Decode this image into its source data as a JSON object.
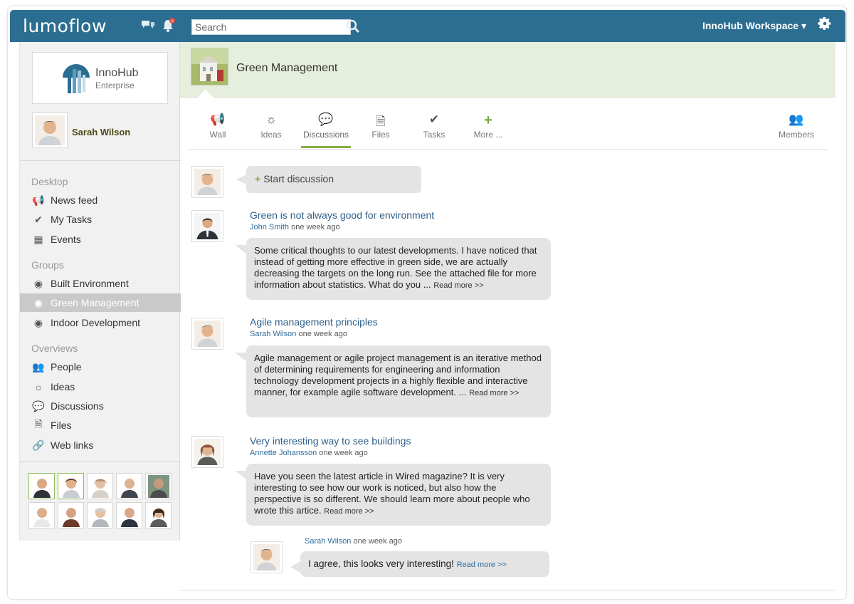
{
  "topbar": {
    "logo": "lumoflow",
    "search_placeholder": "Search",
    "workspace": "InnoHub Workspace ▾",
    "accent": "#2b6e91"
  },
  "sidebar": {
    "brand": {
      "name": "InnoHub",
      "sub": "Enterprise"
    },
    "user": {
      "name": "Sarah Wilson"
    },
    "sections": {
      "desktop": "Desktop",
      "groups": "Groups",
      "overviews": "Overviews"
    },
    "desktop_items": [
      {
        "label": "News feed",
        "icon": "megaphone-icon"
      },
      {
        "label": "My Tasks",
        "icon": "check-circle-icon"
      },
      {
        "label": "Events",
        "icon": "calendar-icon"
      }
    ],
    "group_items": [
      {
        "label": "Built Environment",
        "icon": "group-icon"
      },
      {
        "label": "Green Management",
        "icon": "group-icon",
        "active": true
      },
      {
        "label": "Indoor Development",
        "icon": "group-icon"
      }
    ],
    "overview_items": [
      {
        "label": "People",
        "icon": "people-icon"
      },
      {
        "label": "Ideas",
        "icon": "lightbulb-icon"
      },
      {
        "label": "Discussions",
        "icon": "speech-bubbles-icon"
      },
      {
        "label": "Files",
        "icon": "file-icon"
      },
      {
        "label": "Web links",
        "icon": "link-icon"
      }
    ]
  },
  "group": {
    "title": "Green Management",
    "header_color": "#e6eedd"
  },
  "tabs": [
    {
      "label": "Wall",
      "icon": "megaphone-icon"
    },
    {
      "label": "Ideas",
      "icon": "lightbulb-icon"
    },
    {
      "label": "Discussions",
      "icon": "speech-bubbles-icon",
      "active": true
    },
    {
      "label": "Files",
      "icon": "file-icon"
    },
    {
      "label": "Tasks",
      "icon": "check-circle-icon"
    },
    {
      "label": "More ...",
      "icon": "plus-icon"
    },
    {
      "label": "Members",
      "icon": "people-icon"
    }
  ],
  "feed": {
    "start_discussion": "Start discussion",
    "posts": [
      {
        "title": "Green is not always good for environment",
        "author": "John Smith",
        "time": "one week ago",
        "body": "Some critical thoughts to our latest developments. I have noticed that instead of getting more effective in green side, we are actually decreasing the targets on the long run. See the attached file for more information about statistics. What do you ...",
        "read_more": "Read more >>"
      },
      {
        "title": "Agile management principles",
        "author": "Sarah Wilson",
        "time": "one week ago",
        "body": "Agile management or agile project management is an iterative method of determining requirements for engineering and information technology development projects in a highly flexible and interactive manner, for example agile software development. ...",
        "read_more": "Read more >>"
      },
      {
        "title": "Very interesting way to see buildings",
        "author": "Annette Johansson",
        "time": "one week ago",
        "body": "Have you seen the latest article in Wired magazine? It is very interesting to see how our work is noticed, but also how the perspective is so different. We should learn more about people who wrote this artice.",
        "read_more": "Read more >>"
      }
    ],
    "reply": {
      "author": "Sarah Wilson",
      "time": "one week ago",
      "body": "I agree, this looks very interesting!",
      "read_more": "Read more >>"
    }
  }
}
